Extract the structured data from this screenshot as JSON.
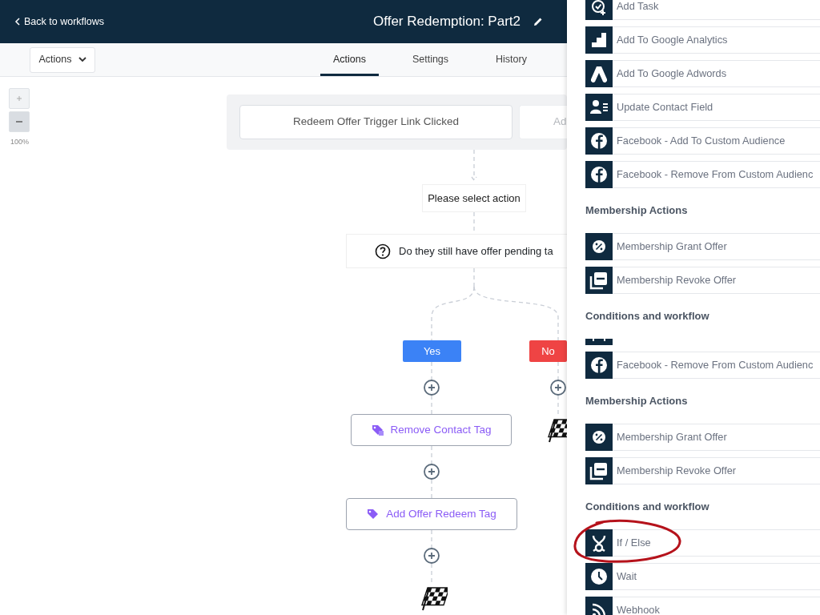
{
  "header": {
    "back_link": "Back to workflows",
    "title": "Offer Redemption: Part2"
  },
  "toolbar": {
    "dropdown": "Actions",
    "tabs": [
      {
        "label": "Actions",
        "selected": true
      },
      {
        "label": "Settings",
        "selected": false
      },
      {
        "label": "History",
        "selected": false
      }
    ]
  },
  "zoom": {
    "level_text": "100%"
  },
  "canvas": {
    "triggers": [
      {
        "label": "Redeem Offer Trigger Link Clicked",
        "kind": "trigger"
      },
      {
        "label": "Ad",
        "kind": "add"
      }
    ],
    "action_prompt": "Please select action",
    "condition": "Do they still have offer pending ta",
    "branches": [
      {
        "label": "Yes",
        "color": "#3b82f6",
        "steps": [
          {
            "label": "Remove Contact Tag",
            "kind": "remove_tag"
          },
          {
            "label": "Add Offer Redeem Tag",
            "kind": "add_tag"
          }
        ]
      },
      {
        "label": "No",
        "color": "#ef4444"
      }
    ]
  },
  "panel": {
    "sections": [
      {
        "items": [
          {
            "label": "Add Task",
            "kind": "task",
            "highlighted": false
          },
          {
            "label": "Add To Google Analytics",
            "kind": "analytics",
            "highlighted": false
          },
          {
            "label": "Add To Google Adwords",
            "kind": "adwords",
            "highlighted": false
          },
          {
            "label": "Update Contact Field",
            "kind": "contact",
            "highlighted": false
          },
          {
            "label": "Facebook - Add To Custom Audience",
            "kind": "facebook",
            "highlighted": false
          },
          {
            "label": "Facebook - Remove From Custom Audienc",
            "kind": "facebook",
            "highlighted": false
          }
        ]
      },
      {
        "heading": "Membership Actions",
        "items": [
          {
            "label": "Membership Grant Offer",
            "kind": "percent",
            "highlighted": false
          },
          {
            "label": "Membership Revoke Offer",
            "kind": "revoke",
            "highlighted": false
          }
        ]
      },
      {
        "heading": "Conditions and workflow",
        "items": [
          {
            "kind": "clipped"
          },
          {
            "label": "Facebook - Remove From Custom Audienc",
            "kind": "facebook",
            "highlighted": false
          }
        ]
      },
      {
        "heading": "Membership Actions",
        "items": [
          {
            "label": "Membership Grant Offer",
            "kind": "percent",
            "highlighted": false
          },
          {
            "label": "Membership Revoke Offer",
            "kind": "revoke",
            "highlighted": false
          }
        ]
      },
      {
        "heading": "Conditions and workflow",
        "items": [
          {
            "label": "If / Else",
            "kind": "ifelse",
            "highlighted": true
          },
          {
            "label": "Wait",
            "kind": "clock",
            "highlighted": false
          },
          {
            "label": "Webhook",
            "kind": "rss",
            "highlighted": false
          }
        ]
      }
    ]
  }
}
